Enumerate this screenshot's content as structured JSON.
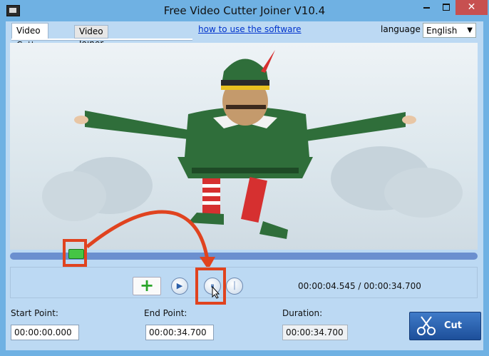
{
  "window": {
    "title": "Free Video Cutter Joiner V10.4",
    "close_glyph": "✕"
  },
  "tabs": [
    {
      "label": "Video Cutter",
      "active": true
    },
    {
      "label": "Video Joiner",
      "active": false
    }
  ],
  "help_link": "how to use the software",
  "language": {
    "label": "language",
    "selected": "English"
  },
  "seek": {
    "position": 0.13
  },
  "controls": {
    "add_icon": "plus-icon",
    "play_icon": "play-icon",
    "mark_start_icon": "mark-start-icon",
    "mark_end_icon": "mark-end-icon",
    "time_readout": "00:00:04.545 / 00:00:34.700"
  },
  "fields": {
    "start_label": "Start Point:",
    "start_value": "00:00:00.000",
    "end_label": "End Point:",
    "end_value": "00:00:34.700",
    "duration_label": "Duration:",
    "duration_value": "00:00:34.700"
  },
  "cut_button": {
    "label": "Cut",
    "icon": "scissors-icon"
  },
  "colors": {
    "highlight": "#e0431f",
    "seek_bar": "#6b8fcf",
    "handle": "#45c545",
    "cut_button": "#2a62b0"
  }
}
